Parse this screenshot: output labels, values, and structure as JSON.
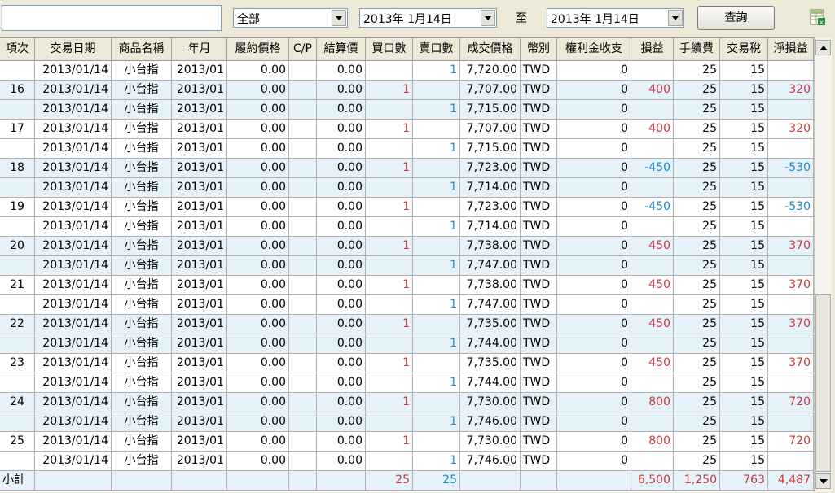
{
  "filters": {
    "product": "全部",
    "date_from": "2013年  1月14日",
    "to_label": "至",
    "date_to": "2013年  1月14日",
    "query_button": "查詢",
    "export_icon": "excel-export-icon"
  },
  "columns": [
    "項次",
    "交易日期",
    "商品名稱",
    "年月",
    "履約價格",
    "C/P",
    "結算價",
    "買口數",
    "賣口數",
    "成交價格",
    "幣別",
    "權利金收支",
    "損益",
    "手續費",
    "交易稅",
    "淨損益"
  ],
  "rows": [
    {
      "item": "",
      "date": "2013/01/14",
      "product": "小台指",
      "ym": "2013/01",
      "strike": "0.00",
      "cp": "",
      "settle": "0.00",
      "buy": "",
      "sell": "1",
      "price": "7,720.00",
      "cur": "TWD",
      "premium": "0",
      "pl": "",
      "fee": "25",
      "tax": "15",
      "net": ""
    },
    {
      "item": "16",
      "date": "2013/01/14",
      "product": "小台指",
      "ym": "2013/01",
      "strike": "0.00",
      "cp": "",
      "settle": "0.00",
      "buy": "1",
      "sell": "",
      "price": "7,707.00",
      "cur": "TWD",
      "premium": "0",
      "pl": "400",
      "fee": "25",
      "tax": "15",
      "net": "320"
    },
    {
      "item": "",
      "date": "2013/01/14",
      "product": "小台指",
      "ym": "2013/01",
      "strike": "0.00",
      "cp": "",
      "settle": "0.00",
      "buy": "",
      "sell": "1",
      "price": "7,715.00",
      "cur": "TWD",
      "premium": "0",
      "pl": "",
      "fee": "25",
      "tax": "15",
      "net": ""
    },
    {
      "item": "17",
      "date": "2013/01/14",
      "product": "小台指",
      "ym": "2013/01",
      "strike": "0.00",
      "cp": "",
      "settle": "0.00",
      "buy": "1",
      "sell": "",
      "price": "7,707.00",
      "cur": "TWD",
      "premium": "0",
      "pl": "400",
      "fee": "25",
      "tax": "15",
      "net": "320"
    },
    {
      "item": "",
      "date": "2013/01/14",
      "product": "小台指",
      "ym": "2013/01",
      "strike": "0.00",
      "cp": "",
      "settle": "0.00",
      "buy": "",
      "sell": "1",
      "price": "7,715.00",
      "cur": "TWD",
      "premium": "0",
      "pl": "",
      "fee": "25",
      "tax": "15",
      "net": ""
    },
    {
      "item": "18",
      "date": "2013/01/14",
      "product": "小台指",
      "ym": "2013/01",
      "strike": "0.00",
      "cp": "",
      "settle": "0.00",
      "buy": "1",
      "sell": "",
      "price": "7,723.00",
      "cur": "TWD",
      "premium": "0",
      "pl": "-450",
      "fee": "25",
      "tax": "15",
      "net": "-530"
    },
    {
      "item": "",
      "date": "2013/01/14",
      "product": "小台指",
      "ym": "2013/01",
      "strike": "0.00",
      "cp": "",
      "settle": "0.00",
      "buy": "",
      "sell": "1",
      "price": "7,714.00",
      "cur": "TWD",
      "premium": "0",
      "pl": "",
      "fee": "25",
      "tax": "15",
      "net": ""
    },
    {
      "item": "19",
      "date": "2013/01/14",
      "product": "小台指",
      "ym": "2013/01",
      "strike": "0.00",
      "cp": "",
      "settle": "0.00",
      "buy": "1",
      "sell": "",
      "price": "7,723.00",
      "cur": "TWD",
      "premium": "0",
      "pl": "-450",
      "fee": "25",
      "tax": "15",
      "net": "-530"
    },
    {
      "item": "",
      "date": "2013/01/14",
      "product": "小台指",
      "ym": "2013/01",
      "strike": "0.00",
      "cp": "",
      "settle": "0.00",
      "buy": "",
      "sell": "1",
      "price": "7,714.00",
      "cur": "TWD",
      "premium": "0",
      "pl": "",
      "fee": "25",
      "tax": "15",
      "net": ""
    },
    {
      "item": "20",
      "date": "2013/01/14",
      "product": "小台指",
      "ym": "2013/01",
      "strike": "0.00",
      "cp": "",
      "settle": "0.00",
      "buy": "1",
      "sell": "",
      "price": "7,738.00",
      "cur": "TWD",
      "premium": "0",
      "pl": "450",
      "fee": "25",
      "tax": "15",
      "net": "370"
    },
    {
      "item": "",
      "date": "2013/01/14",
      "product": "小台指",
      "ym": "2013/01",
      "strike": "0.00",
      "cp": "",
      "settle": "0.00",
      "buy": "",
      "sell": "1",
      "price": "7,747.00",
      "cur": "TWD",
      "premium": "0",
      "pl": "",
      "fee": "25",
      "tax": "15",
      "net": ""
    },
    {
      "item": "21",
      "date": "2013/01/14",
      "product": "小台指",
      "ym": "2013/01",
      "strike": "0.00",
      "cp": "",
      "settle": "0.00",
      "buy": "1",
      "sell": "",
      "price": "7,738.00",
      "cur": "TWD",
      "premium": "0",
      "pl": "450",
      "fee": "25",
      "tax": "15",
      "net": "370"
    },
    {
      "item": "",
      "date": "2013/01/14",
      "product": "小台指",
      "ym": "2013/01",
      "strike": "0.00",
      "cp": "",
      "settle": "0.00",
      "buy": "",
      "sell": "1",
      "price": "7,747.00",
      "cur": "TWD",
      "premium": "0",
      "pl": "",
      "fee": "25",
      "tax": "15",
      "net": ""
    },
    {
      "item": "22",
      "date": "2013/01/14",
      "product": "小台指",
      "ym": "2013/01",
      "strike": "0.00",
      "cp": "",
      "settle": "0.00",
      "buy": "1",
      "sell": "",
      "price": "7,735.00",
      "cur": "TWD",
      "premium": "0",
      "pl": "450",
      "fee": "25",
      "tax": "15",
      "net": "370"
    },
    {
      "item": "",
      "date": "2013/01/14",
      "product": "小台指",
      "ym": "2013/01",
      "strike": "0.00",
      "cp": "",
      "settle": "0.00",
      "buy": "",
      "sell": "1",
      "price": "7,744.00",
      "cur": "TWD",
      "premium": "0",
      "pl": "",
      "fee": "25",
      "tax": "15",
      "net": ""
    },
    {
      "item": "23",
      "date": "2013/01/14",
      "product": "小台指",
      "ym": "2013/01",
      "strike": "0.00",
      "cp": "",
      "settle": "0.00",
      "buy": "1",
      "sell": "",
      "price": "7,735.00",
      "cur": "TWD",
      "premium": "0",
      "pl": "450",
      "fee": "25",
      "tax": "15",
      "net": "370"
    },
    {
      "item": "",
      "date": "2013/01/14",
      "product": "小台指",
      "ym": "2013/01",
      "strike": "0.00",
      "cp": "",
      "settle": "0.00",
      "buy": "",
      "sell": "1",
      "price": "7,744.00",
      "cur": "TWD",
      "premium": "0",
      "pl": "",
      "fee": "25",
      "tax": "15",
      "net": ""
    },
    {
      "item": "24",
      "date": "2013/01/14",
      "product": "小台指",
      "ym": "2013/01",
      "strike": "0.00",
      "cp": "",
      "settle": "0.00",
      "buy": "1",
      "sell": "",
      "price": "7,730.00",
      "cur": "TWD",
      "premium": "0",
      "pl": "800",
      "fee": "25",
      "tax": "15",
      "net": "720"
    },
    {
      "item": "",
      "date": "2013/01/14",
      "product": "小台指",
      "ym": "2013/01",
      "strike": "0.00",
      "cp": "",
      "settle": "0.00",
      "buy": "",
      "sell": "1",
      "price": "7,746.00",
      "cur": "TWD",
      "premium": "0",
      "pl": "",
      "fee": "25",
      "tax": "15",
      "net": ""
    },
    {
      "item": "25",
      "date": "2013/01/14",
      "product": "小台指",
      "ym": "2013/01",
      "strike": "0.00",
      "cp": "",
      "settle": "0.00",
      "buy": "1",
      "sell": "",
      "price": "7,730.00",
      "cur": "TWD",
      "premium": "0",
      "pl": "800",
      "fee": "25",
      "tax": "15",
      "net": "720"
    },
    {
      "item": "",
      "date": "2013/01/14",
      "product": "小台指",
      "ym": "2013/01",
      "strike": "0.00",
      "cp": "",
      "settle": "0.00",
      "buy": "",
      "sell": "1",
      "price": "7,746.00",
      "cur": "TWD",
      "premium": "0",
      "pl": "",
      "fee": "25",
      "tax": "15",
      "net": ""
    }
  ],
  "subtotal": {
    "label": "小計",
    "buy": "25",
    "sell": "25",
    "pl": "6,500",
    "fee": "1,250",
    "tax": "763",
    "net": "4,487"
  },
  "colors": {
    "positive": "#c8373b",
    "negative": "#1a88c8",
    "buy": "#c8373b",
    "sell": "#1a88c8",
    "shade": "#e6f2fa"
  }
}
